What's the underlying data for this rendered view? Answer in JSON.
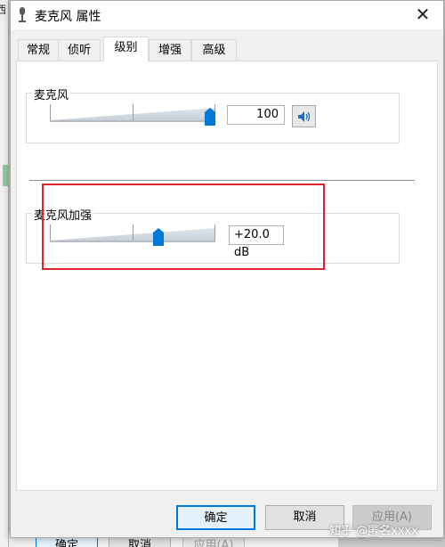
{
  "background": {
    "left_char": "西",
    "ok_label": "确定",
    "cancel_label": "取消",
    "apply_label": "应用(A)"
  },
  "window": {
    "title": "麦克风 属性",
    "icon": "microphone-icon",
    "close_symbol": "✕"
  },
  "tabs": [
    {
      "label": "常规",
      "active": false
    },
    {
      "label": "侦听",
      "active": false
    },
    {
      "label": "级别",
      "active": true
    },
    {
      "label": "增强",
      "active": false
    },
    {
      "label": "高级",
      "active": false
    }
  ],
  "microphone": {
    "label": "麦克风",
    "value": "100",
    "level_fraction": 1.0,
    "speaker_icon": "speaker-icon"
  },
  "boost": {
    "label": "麦克风加强",
    "value": "+20.0 dB",
    "level_fraction": 0.667
  },
  "buttons": {
    "ok": "确定",
    "cancel": "取消",
    "apply": "应用(A)"
  },
  "colors": {
    "accent": "#0078d7",
    "highlight": "#e0232b"
  },
  "watermark": "知乎 @匿名xxxx"
}
